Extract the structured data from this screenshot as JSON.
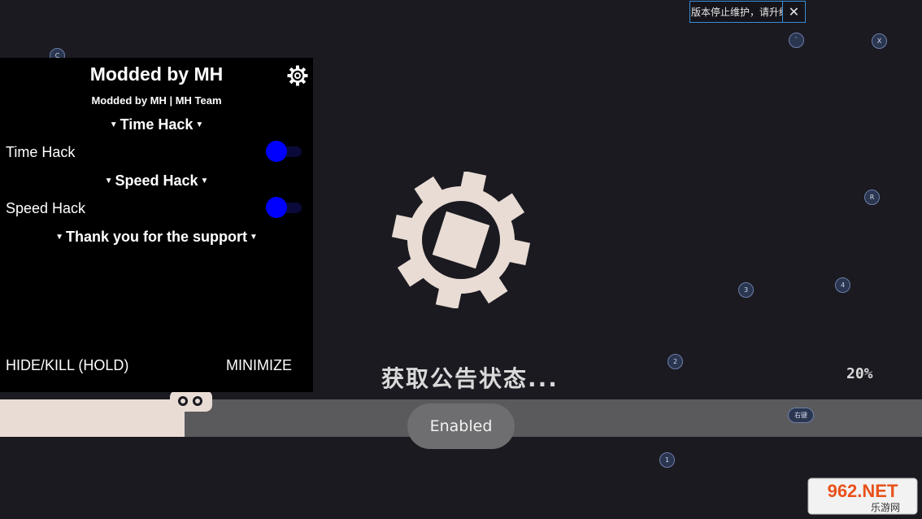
{
  "notice": {
    "text": "版本停止维护，请升级",
    "close_icon": "close-icon"
  },
  "keys": {
    "c": "C",
    "backtick": "`",
    "x": "X",
    "r": "R",
    "k3": "3",
    "k4": "4",
    "k2": "2",
    "k1": "1",
    "right_key": "右键"
  },
  "menu": {
    "title": "Modded by MH",
    "subtitle": "Modded by MH  | MH Team",
    "sections": [
      {
        "label": "Time Hack"
      },
      {
        "label": "Speed Hack"
      },
      {
        "label": "Thank you for the support"
      }
    ],
    "rows": [
      {
        "label": "Time Hack",
        "enabled": true
      },
      {
        "label": "Speed Hack",
        "enabled": true
      }
    ],
    "hide_kill_label": "HIDE/KILL (HOLD)",
    "minimize_label": "MINIMIZE",
    "accent_color": "#0000ff"
  },
  "loading": {
    "status_text": "获取公告状态...",
    "percent_text": "20%",
    "progress": 0.2
  },
  "toast": {
    "text": "Enabled"
  },
  "watermark": {
    "text": "962.NET",
    "sub": "乐游网"
  }
}
